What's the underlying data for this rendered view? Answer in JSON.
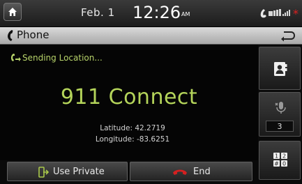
{
  "status_bar": {
    "date": "Feb.  1",
    "time": "12:26",
    "ampm": "AM"
  },
  "title_bar": {
    "title": "Phone"
  },
  "call": {
    "sending_status": "Sending Location...",
    "title": "911 Connect",
    "latitude_text": "Latitude: 42.2719",
    "longitude_text": "Longitude: -83.6251"
  },
  "side_buttons": {
    "mute_count": "3"
  },
  "bottom_buttons": {
    "use_private_label": "Use Private",
    "end_label": "End"
  },
  "icons": {
    "home": "home-icon",
    "phone": "phone-handset-icon",
    "back": "back-arrow-icon",
    "contacts": "contacts-icon",
    "mute": "microphone-mute-icon",
    "keypad": "keypad-icon",
    "end": "end-call-icon",
    "use_private": "handset-transfer-icon"
  },
  "colors": {
    "accent_green": "#b4d45a",
    "end_red": "#d42020",
    "status_red": "#e02020"
  }
}
